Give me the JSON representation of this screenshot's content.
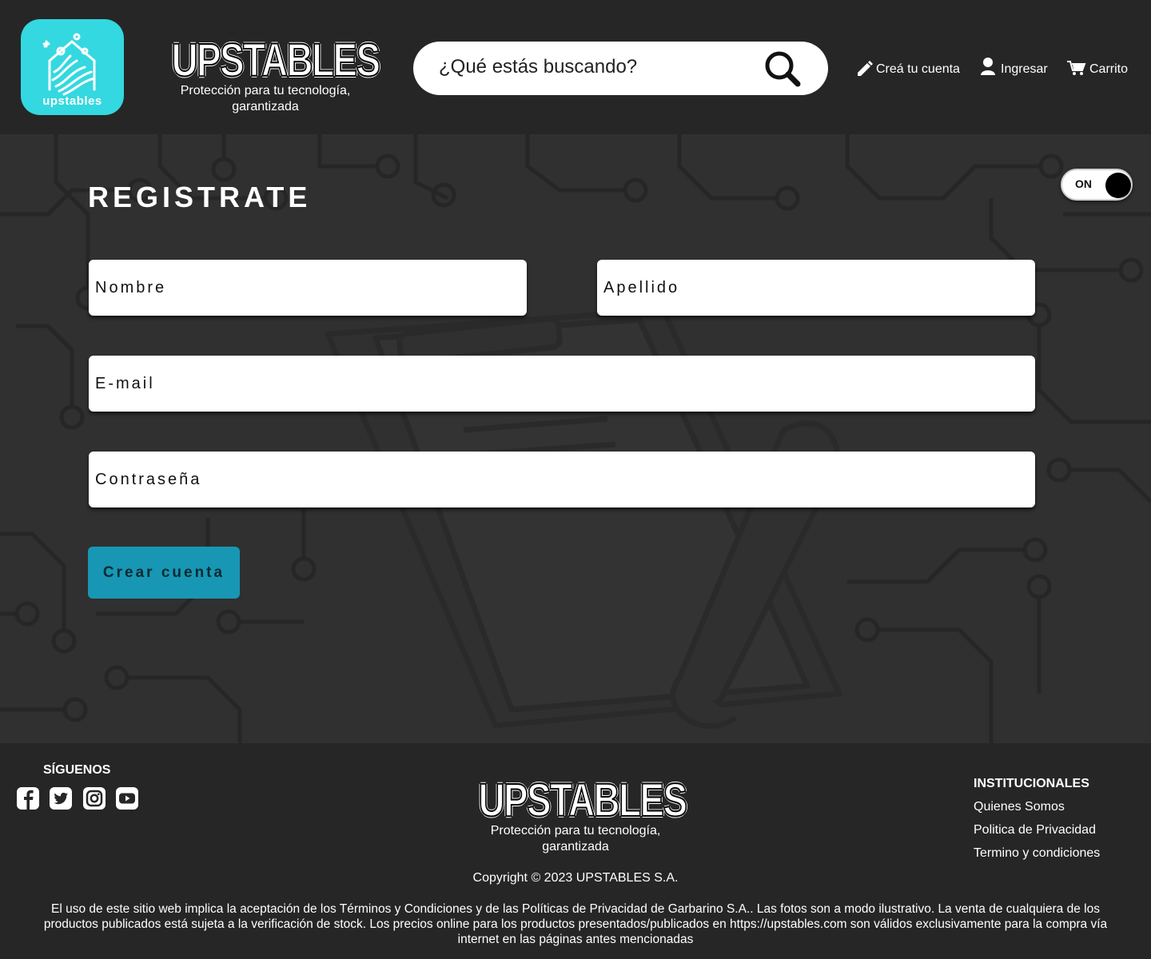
{
  "header": {
    "logo_word": "upstables",
    "brand_title": "UPSTABLES",
    "brand_subtitle": "Protección para tu tecnología, garantizada",
    "search": {
      "placeholder": "¿Qué estás buscando?"
    },
    "nav": {
      "create_account": "Creá tu cuenta",
      "login": "Ingresar",
      "cart": "Carrito"
    }
  },
  "form": {
    "title": "REGISTRATE",
    "toggle_label": "ON",
    "first_name_placeholder": "Nombre",
    "last_name_placeholder": "Apellido",
    "email_placeholder": "E-mail",
    "password_placeholder": "Contraseña",
    "submit_label": "Crear cuenta"
  },
  "footer": {
    "follow_title": "SÍGUENOS",
    "social": [
      "facebook-icon",
      "twitter-icon",
      "instagram-icon",
      "youtube-icon"
    ],
    "brand_title": "UPSTABLES",
    "brand_subtitle": "Protección para tu tecnología, garantizada",
    "copyright": "Copyright © 2023 UPSTABLES S.A.",
    "institutional_title": "INSTITUCIONALES",
    "institutional_links": [
      "Quienes Somos",
      "Politica de Privacidad",
      "Termino y condiciones"
    ],
    "legal": "El uso de este sitio web implica la aceptación de los Términos y Condiciones y de las Políticas de Privacidad de Garbarino S.A.. Las fotos son a modo ilustrativo. La venta de cualquiera de los productos publicados está sujeta a la verificación de stock. Los precios online para los productos presentados/publicados en https://upstables.com  son válidos exclusivamente para la compra vía internet en las páginas antes mencionadas"
  },
  "colors": {
    "header_bg": "#262626",
    "main_bg": "#303030",
    "accent": "#34d8e0",
    "button": "#1797b4"
  }
}
